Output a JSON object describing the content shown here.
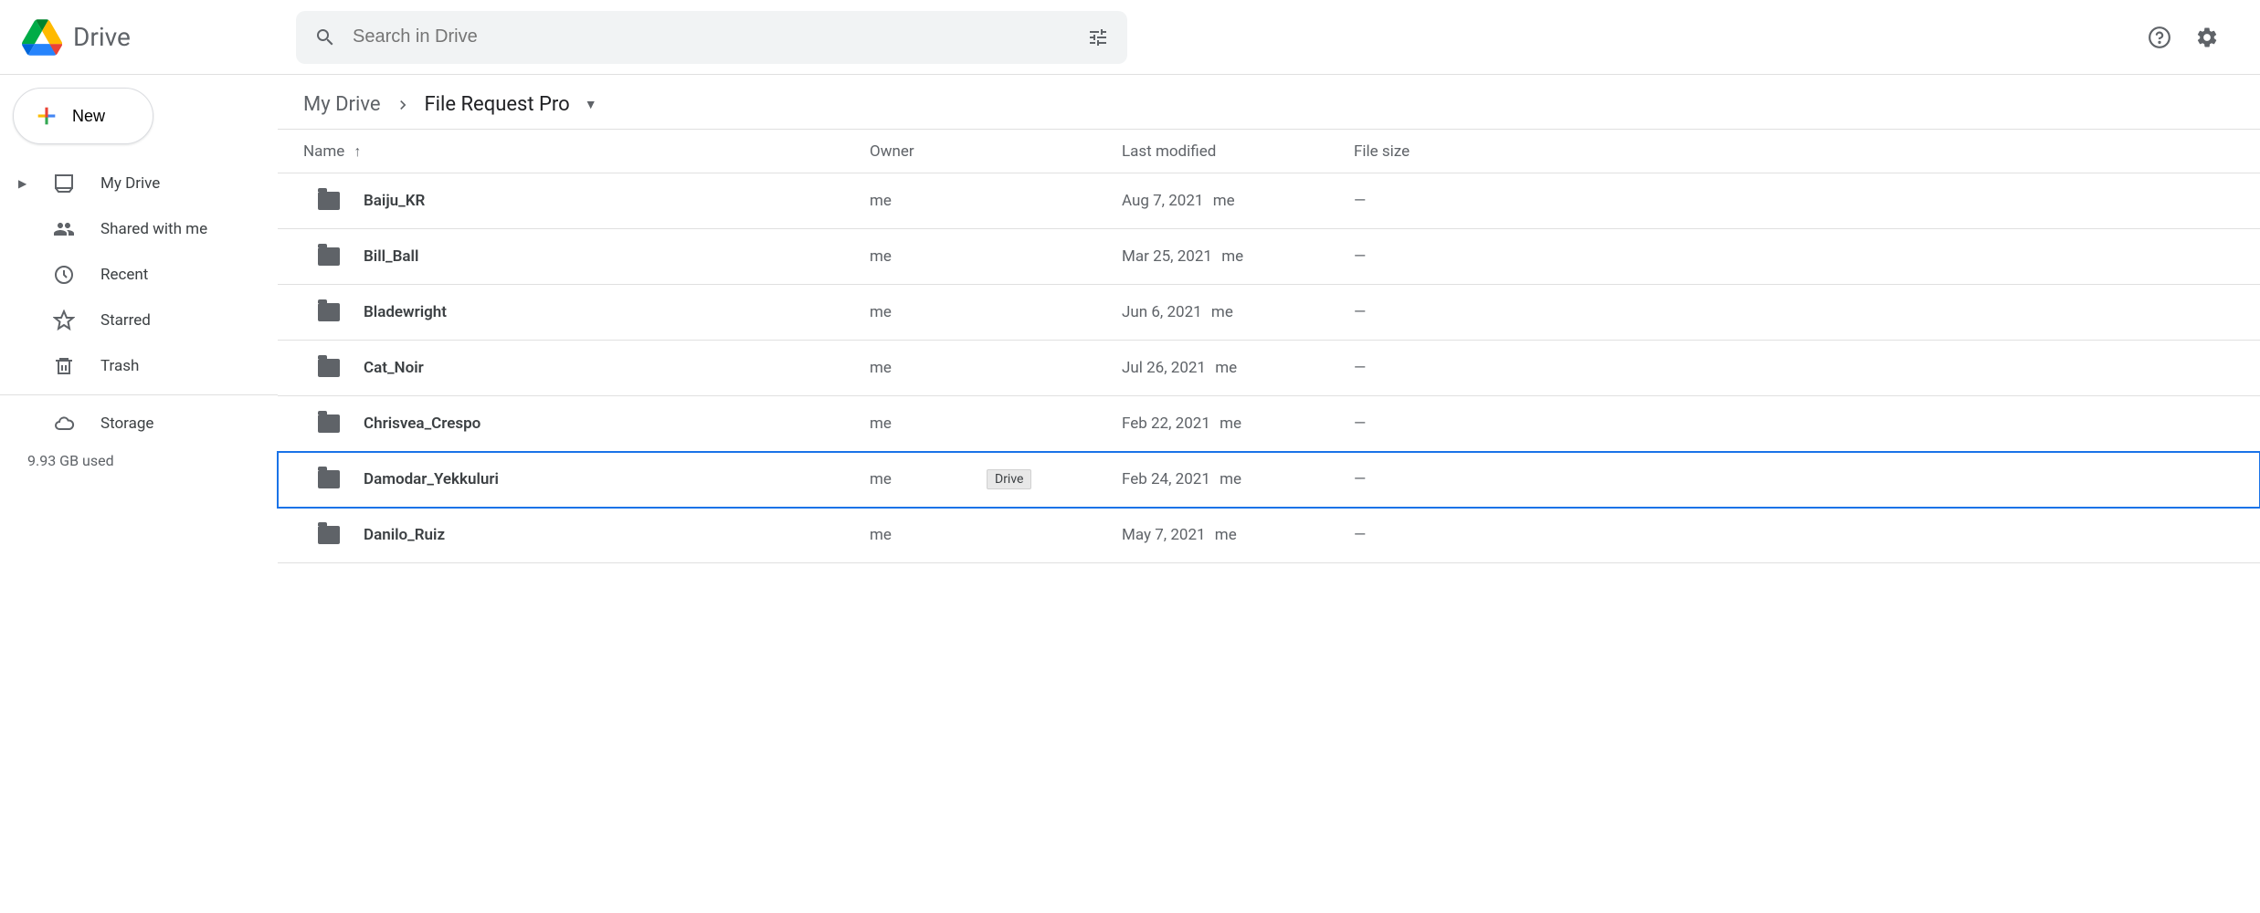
{
  "app": {
    "name": "Drive",
    "search_placeholder": "Search in Drive"
  },
  "sidebar": {
    "new_label": "New",
    "items": [
      {
        "label": "My Drive",
        "expandable": true
      },
      {
        "label": "Shared with me",
        "expandable": false
      },
      {
        "label": "Recent",
        "expandable": false
      },
      {
        "label": "Starred",
        "expandable": false
      },
      {
        "label": "Trash",
        "expandable": false
      }
    ],
    "storage_label": "Storage",
    "storage_used": "9.93 GB used"
  },
  "breadcrumb": {
    "root": "My Drive",
    "current": "File Request Pro"
  },
  "columns": {
    "name": "Name",
    "owner": "Owner",
    "modified": "Last modified",
    "size": "File size"
  },
  "rows": [
    {
      "name": "Baiju_KR",
      "owner": "me",
      "modified": "Aug 7, 2021",
      "modified_by": "me",
      "size": "—",
      "selected": false
    },
    {
      "name": "Bill_Ball",
      "owner": "me",
      "modified": "Mar 25, 2021",
      "modified_by": "me",
      "size": "—",
      "selected": false
    },
    {
      "name": "Bladewright",
      "owner": "me",
      "modified": "Jun 6, 2021",
      "modified_by": "me",
      "size": "—",
      "selected": false
    },
    {
      "name": "Cat_Noir",
      "owner": "me",
      "modified": "Jul 26, 2021",
      "modified_by": "me",
      "size": "—",
      "selected": false
    },
    {
      "name": "Chrisvea_Crespo",
      "owner": "me",
      "modified": "Feb 22, 2021",
      "modified_by": "me",
      "size": "—",
      "selected": false
    },
    {
      "name": "Damodar_Yekkuluri",
      "owner": "me",
      "modified": "Feb 24, 2021",
      "modified_by": "me",
      "size": "—",
      "selected": true,
      "tooltip": "Drive"
    },
    {
      "name": "Danilo_Ruiz",
      "owner": "me",
      "modified": "May 7, 2021",
      "modified_by": "me",
      "size": "—",
      "selected": false
    }
  ]
}
